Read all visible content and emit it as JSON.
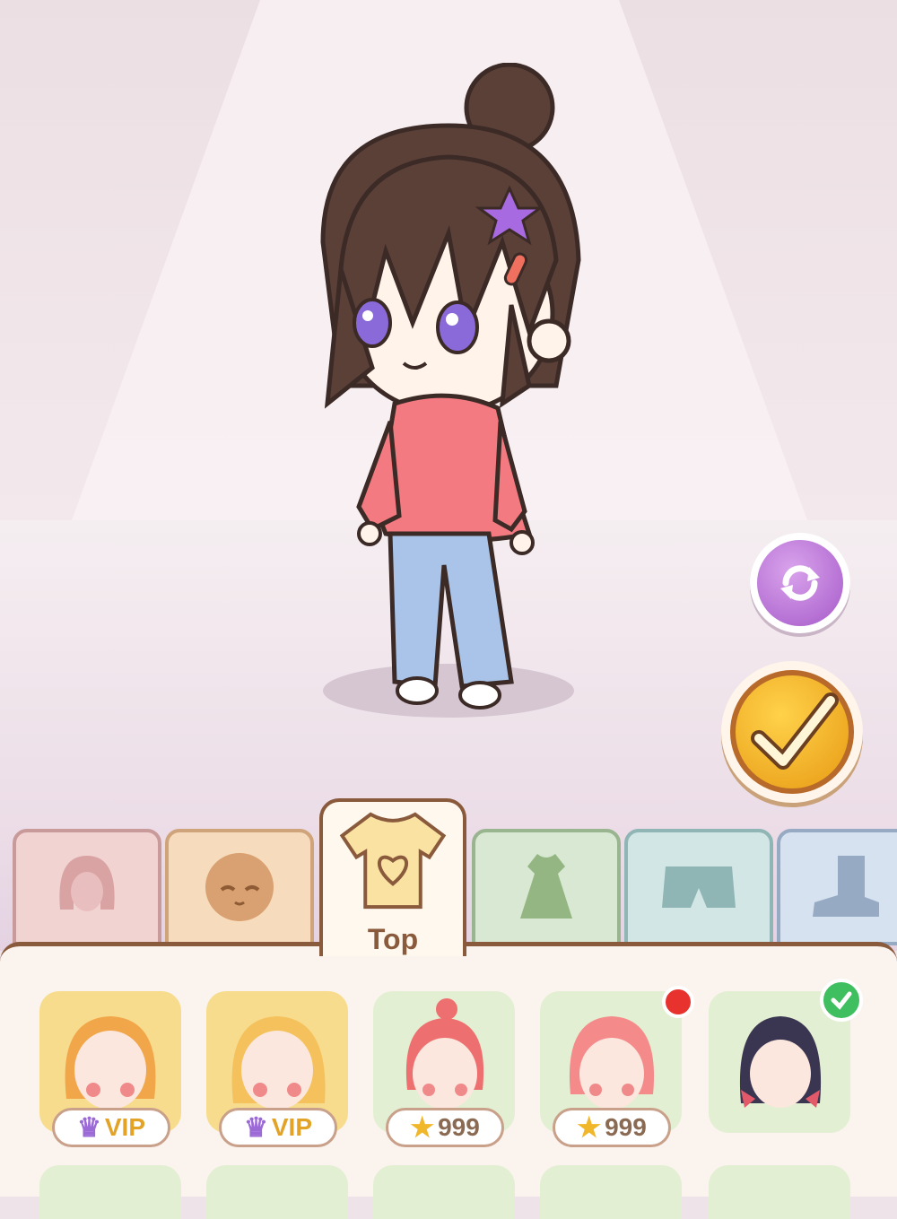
{
  "theme": {
    "accent_brown": "#8a5a3c",
    "vip_gold": "#e2a326",
    "confirm_orange": "#e89a14",
    "refresh_purple": "#a65ac9",
    "new_badge_red": "#e8322e",
    "equipped_green": "#3fbf5f"
  },
  "actions": {
    "refresh_icon": "refresh-arrows-icon",
    "confirm_icon": "checkmark-icon"
  },
  "tabs": [
    {
      "id": "hair",
      "icon": "hair-icon",
      "active": false
    },
    {
      "id": "face",
      "icon": "face-icon",
      "active": false
    },
    {
      "id": "top",
      "icon": "shirt-icon",
      "label": "Top",
      "active": true
    },
    {
      "id": "dress",
      "icon": "dress-icon",
      "active": false
    },
    {
      "id": "pants",
      "icon": "shorts-icon",
      "active": false
    },
    {
      "id": "shoes",
      "icon": "boot-icon",
      "active": false
    }
  ],
  "items": [
    {
      "kind": "vip",
      "price_label": "VIP",
      "price_icon": "crown-icon",
      "hair_color": "#f1a64a"
    },
    {
      "kind": "vip",
      "price_label": "VIP",
      "price_icon": "crown-icon",
      "hair_color": "#f5c15c"
    },
    {
      "kind": "coin",
      "price_label": "999",
      "price_icon": "star-icon",
      "hair_color": "#ee6f6f"
    },
    {
      "kind": "coin",
      "price_label": "999",
      "price_icon": "star-icon",
      "hair_color": "#f58a8a",
      "is_new": true
    },
    {
      "kind": "owned",
      "hair_color": "#3a3550",
      "equipped": true
    }
  ]
}
